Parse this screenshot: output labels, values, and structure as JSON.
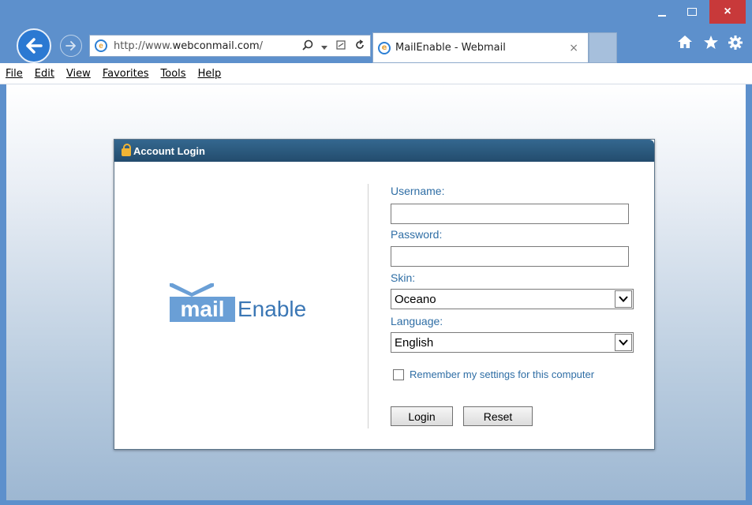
{
  "window": {
    "controls": {
      "minimize": "",
      "maximize": "",
      "close": "×"
    }
  },
  "browser": {
    "url_prefix": "http://www.",
    "url_domain": "webconmail.com",
    "url_suffix": "/",
    "tab_title": "MailEnable - Webmail",
    "tab_close": "×"
  },
  "menu": {
    "items": [
      {
        "label": "File"
      },
      {
        "label": "Edit"
      },
      {
        "label": "View"
      },
      {
        "label": "Favorites"
      },
      {
        "label": "Tools"
      },
      {
        "label": "Help"
      }
    ]
  },
  "login": {
    "header": "Account Login",
    "logo_mail": "mail",
    "logo_enable": "Enable",
    "username_label": "Username:",
    "username_value": "",
    "password_label": "Password:",
    "password_value": "",
    "skin_label": "Skin:",
    "skin_value": "Oceano",
    "language_label": "Language:",
    "language_value": "English",
    "remember_label": "Remember my settings for this computer",
    "login_button": "Login",
    "reset_button": "Reset"
  },
  "colors": {
    "frame": "#5d90cc",
    "close_button": "#c8393a",
    "panel_header": "#2b5a7f",
    "label_blue": "#2f6ea5",
    "logo_blue": "#6a9fd6"
  }
}
